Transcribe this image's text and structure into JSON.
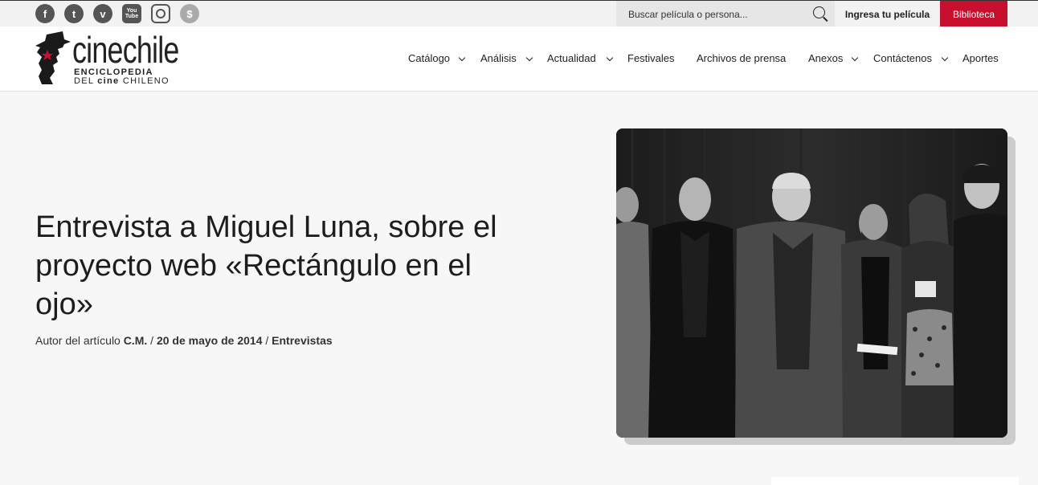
{
  "social": [
    {
      "name": "facebook-icon",
      "glyph": "f"
    },
    {
      "name": "twitter-icon",
      "glyph": "t"
    },
    {
      "name": "vimeo-icon",
      "glyph": "v"
    },
    {
      "name": "youtube-icon",
      "glyph": "You Tube"
    },
    {
      "name": "instagram-icon",
      "glyph": ""
    },
    {
      "name": "donate-icon",
      "glyph": "$"
    }
  ],
  "search": {
    "placeholder": "Buscar película o persona..."
  },
  "topbar": {
    "login_label": "Ingresa tu película",
    "library_label": "Biblioteca"
  },
  "logo": {
    "wordmark": "cinechile",
    "line1": "ENCICLOPEDIA",
    "line2_a": "DEL ",
    "line2_b": "cine",
    "line2_c": " CHILENO"
  },
  "nav": [
    {
      "label": "Catálogo",
      "dropdown": true
    },
    {
      "label": "Análisis",
      "dropdown": true
    },
    {
      "label": "Actualidad",
      "dropdown": true
    },
    {
      "label": "Festivales",
      "dropdown": false
    },
    {
      "label": "Archivos de prensa",
      "dropdown": false
    },
    {
      "label": "Anexos",
      "dropdown": true
    },
    {
      "label": "Contáctenos",
      "dropdown": true
    },
    {
      "label": "Aportes",
      "dropdown": false
    }
  ],
  "article": {
    "title": "Entrevista a Miguel Luna, sobre el proyecto web «Rectángulo en el ojo»",
    "author_prefix": "Autor del artículo ",
    "author": "C.M.",
    "sep": " / ",
    "date": "20 de mayo de 2014",
    "category": "Entrevistas"
  },
  "colors": {
    "accent": "#c8102e"
  }
}
